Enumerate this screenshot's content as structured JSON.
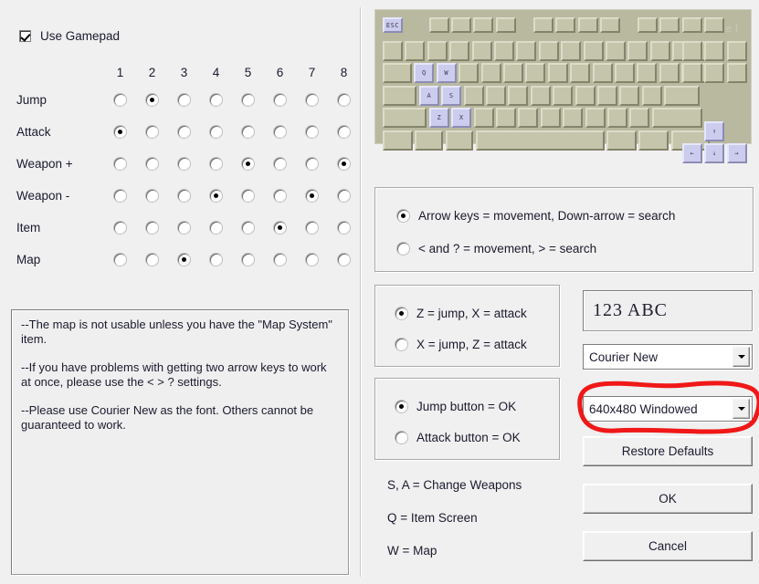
{
  "gamepad": {
    "checkbox_label": "Use Gamepad",
    "checked": true,
    "columns": [
      "1",
      "2",
      "3",
      "4",
      "5",
      "6",
      "7",
      "8"
    ],
    "rows": [
      {
        "label": "Jump",
        "selected": [
          2
        ]
      },
      {
        "label": "Attack",
        "selected": [
          1
        ]
      },
      {
        "label": "Weapon +",
        "selected": [
          5,
          8
        ]
      },
      {
        "label": "Weapon -",
        "selected": [
          4,
          7
        ]
      },
      {
        "label": "Item",
        "selected": [
          6
        ]
      },
      {
        "label": "Map",
        "selected": [
          3
        ]
      }
    ]
  },
  "notes": {
    "paragraphs": [
      "--The map is not usable unless you have the \"Map System\" item.",
      "--If you have problems with getting two arrow keys to work at once, please use the < > ? settings.",
      "--Please use Courier New as the font. Others cannot be guaranteed to work."
    ]
  },
  "keyboard": {
    "brand": "Pixel",
    "esc_label": "ESC",
    "highlighted_keys": [
      "ESC",
      "Q",
      "W",
      "A",
      "S",
      "Z",
      "X",
      "up-arrow",
      "left-arrow",
      "down-arrow",
      "right-arrow"
    ],
    "letter_keys": [
      "Q",
      "W",
      "A",
      "S",
      "Z",
      "X"
    ],
    "arrow_glyphs": {
      "up": "↑",
      "down": "↓",
      "left": "←",
      "right": "→"
    },
    "body_color": "#b9b9a0",
    "key_color": "#c5c5ac",
    "highlight_color": "#ccccee"
  },
  "movement_group": {
    "options": [
      {
        "label": "Arrow keys = movement, Down-arrow = search",
        "selected": true
      },
      {
        "label": "< and ? = movement, > = search",
        "selected": false
      }
    ]
  },
  "jumpkey_group": {
    "options": [
      {
        "label": "Z = jump, X = attack",
        "selected": true
      },
      {
        "label": "X = jump, Z = attack",
        "selected": false
      }
    ]
  },
  "okbutton_group": {
    "options": [
      {
        "label": "Jump button = OK",
        "selected": true
      },
      {
        "label": "Attack button = OK",
        "selected": false
      }
    ]
  },
  "key_hints": [
    "S, A = Change Weapons",
    "Q = Item Screen",
    "W = Map"
  ],
  "font_section": {
    "preview_text": "123  ABC",
    "font_combo_value": "Courier New"
  },
  "resolution_section": {
    "combo_value": "640x480 Windowed"
  },
  "buttons": {
    "restore": "Restore Defaults",
    "ok": "OK",
    "cancel": "Cancel"
  },
  "annotation": {
    "color": "#f01818",
    "shape": "hand-drawn-ellipse-around-resolution-combo"
  }
}
